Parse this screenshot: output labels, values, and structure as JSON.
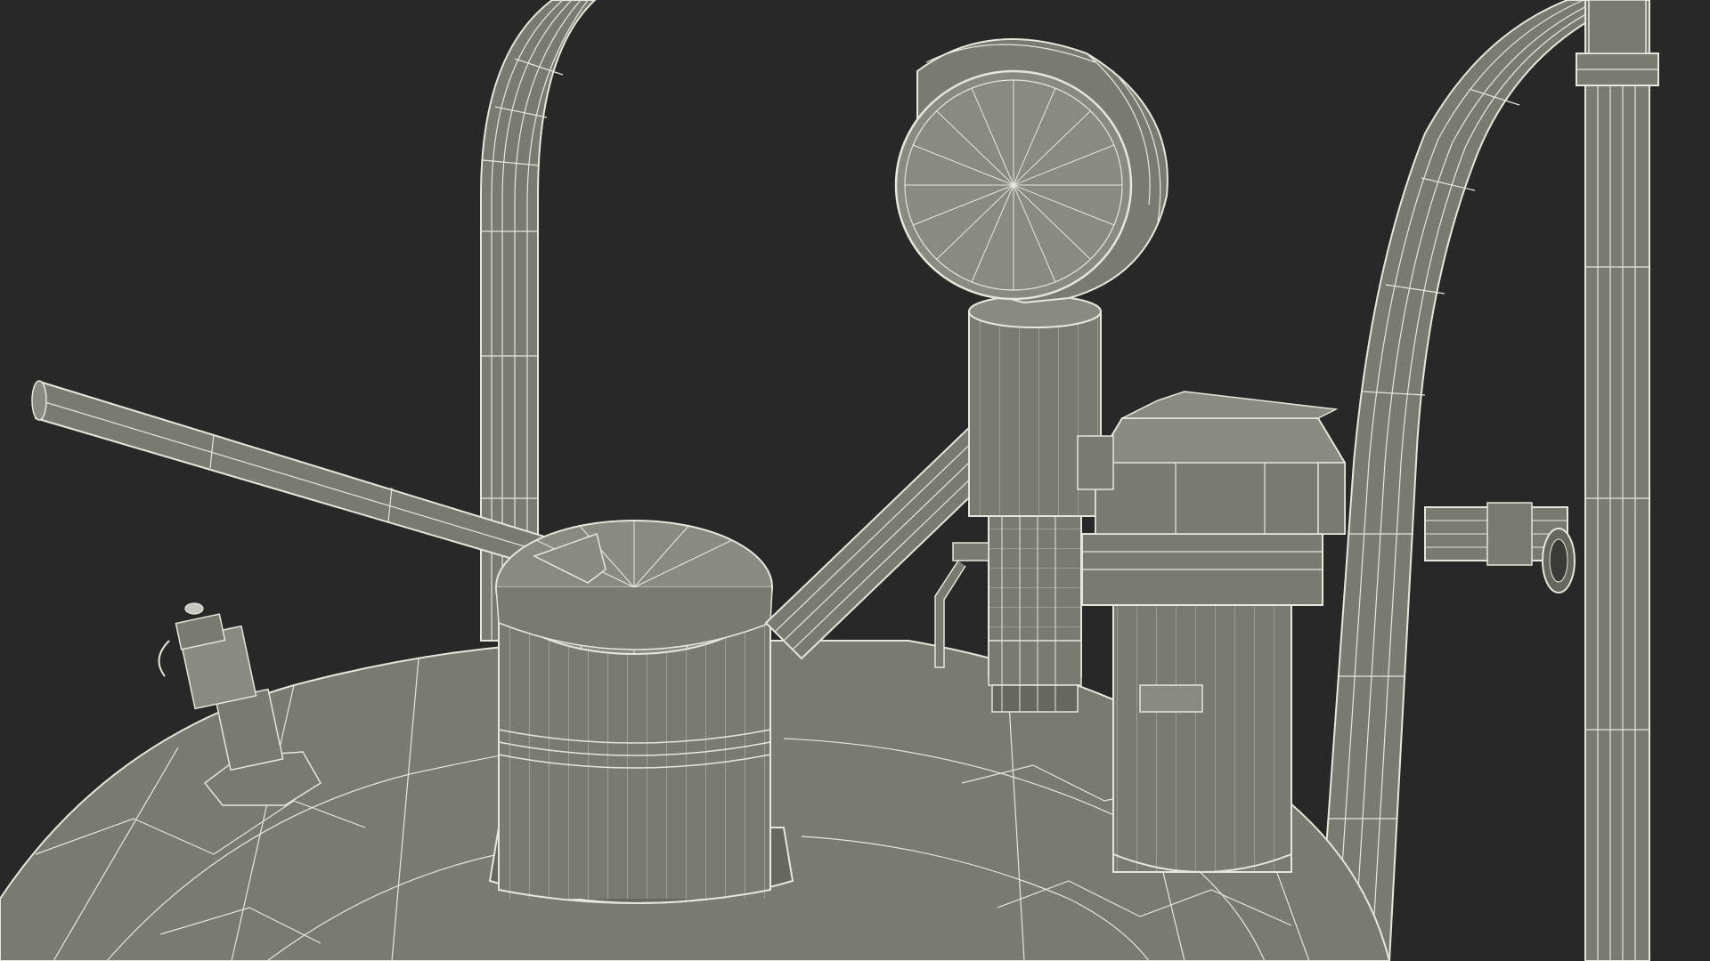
{
  "scene": {
    "subject": "wireframe-render",
    "colors": {
      "background": "#282828",
      "surface": "#7a7b70",
      "surface_dark": "#66675d",
      "surface_light": "#8a8b80",
      "wire": "#e6e6dc"
    }
  }
}
